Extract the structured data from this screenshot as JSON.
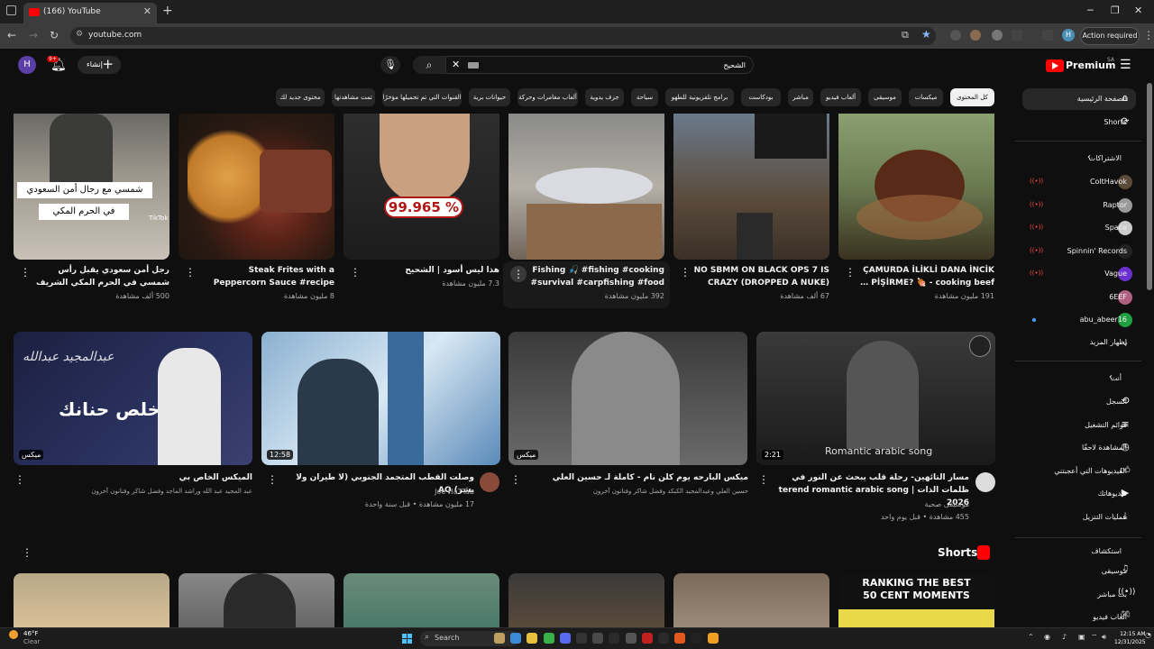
{
  "browser": {
    "tab_title": "(166) YouTube",
    "url": "youtube.com",
    "action_required": "Action required",
    "profile_initial": "H"
  },
  "header": {
    "avatar_initial": "H",
    "notif_count": "9+",
    "create_label": "إنشاء",
    "search_query": "الشحيح",
    "brand": "Premium",
    "brand_region": "SA"
  },
  "chips": [
    "كل المحتوى",
    "ميكسات",
    "موسيقى",
    "ألعاب فيديو",
    "مباشر",
    "بودكاست",
    "برامج تلفزيونية للطهو",
    "سياحة",
    "جزف يدوية",
    "ألعاب مغامرات وحركة",
    "حيوانات برية",
    "القنوات التي تم تحميلها مؤخرًا",
    "تمت مشاهدتها",
    "محتوى جديد لك"
  ],
  "row1": [
    {
      "title": "رجل أمن سعودي يقبل رأس شمسي في الحرم المكي الشريف",
      "meta": "500 ألف مشاهدة",
      "overlay1": "شمسي مع رجال أمن السعودي",
      "overlay2": "في الحرم المكي",
      "badge": "TikTok"
    },
    {
      "title": "Steak Frites with a Peppercorn Sauce #recipe",
      "meta": "8 مليون مشاهدة"
    },
    {
      "title": "هذا ليس أسود | الشحيح",
      "meta": "7.3 مليون مشاهدة",
      "overlay1": "99.965 %"
    },
    {
      "title": "Fishing 🎣 #fishing #cooking #survival #carpfishing #food",
      "meta": "392 مليون مشاهدة"
    },
    {
      "title": "NO SBMM ON BLACK OPS 7 IS CRAZY (DROPPED A NUKE)",
      "meta": "67 ألف مشاهدة"
    },
    {
      "title": "ÇAMURDA İLİKLİ DANA İNCİK PİŞİRME? 🍖 - cooking beef …",
      "meta": "191 مليون مشاهدة"
    }
  ],
  "row2": [
    {
      "title": "الميكس الخاص بي",
      "channel": "عبد المجيد عبد الله وراشد الماجد وفضل شاكر وفنانون آخرون",
      "badge": "ميكس",
      "overlay": "خلص حنانك",
      "overlay2": "عبدالمجيد عبدالله"
    },
    {
      "title": "وصلت القطب المتجمد الجنوبي (لا طيران ولا بشر) AQ",
      "channel": "Joe HaTTab",
      "meta": "17 مليون مشاهدة • قبل سنة واحدة",
      "duration": "12:58"
    },
    {
      "title": "ميكس البارحه يوم كلن نام - كاملة لـ حسين العلي",
      "channel": "حسين العلي وعبدالمجيد الكبكد وفضل شاكر وفنانون آخرون",
      "badge": "ميكس"
    },
    {
      "title": "مسار التائهين- رحلة قلب يبحث عن النور في ظلمات الذات | terend romantic arabic song 2026",
      "channel": "موسيقى صحية",
      "meta": "455 مشاهدة • قبل يوم واحد",
      "duration": "2:21",
      "overlay": "Romantic arabic song"
    }
  ],
  "shorts": {
    "title": "Shorts",
    "card6_line1": "RANKING THE BEST",
    "card6_line2": "50 CENT MOMENTS"
  },
  "sidebar": {
    "home": "الصفحة الرئيسية",
    "shorts": "Shorts",
    "subs_header": "الاشتراكات",
    "subs": [
      "ColtHavok",
      "Raptor",
      "Space",
      "Spinnin' Records",
      "Vague",
      "6EEF",
      "abu_abeer16"
    ],
    "show_more": "إظهار المزيد",
    "you_header": "أنت",
    "you_items": [
      "السجل",
      "قوائم التشغيل",
      "المشاهدة لاحقًا",
      "الفيديوهات التي أعجبتني",
      "فيديوهاتك",
      "عمليات التنزيل"
    ],
    "explore_header": "استكشاف",
    "explore_items": [
      "موسيقى",
      "بث مباشر",
      "ألعاب فيديو"
    ]
  },
  "taskbar": {
    "temp": "46°F",
    "weather": "Clear",
    "search": "Search",
    "time": "12:15 AM",
    "date": "12/31/2025"
  },
  "colors": {
    "accent": "#ff0000",
    "bg": "#0f0f0f",
    "chip": "#272727"
  }
}
